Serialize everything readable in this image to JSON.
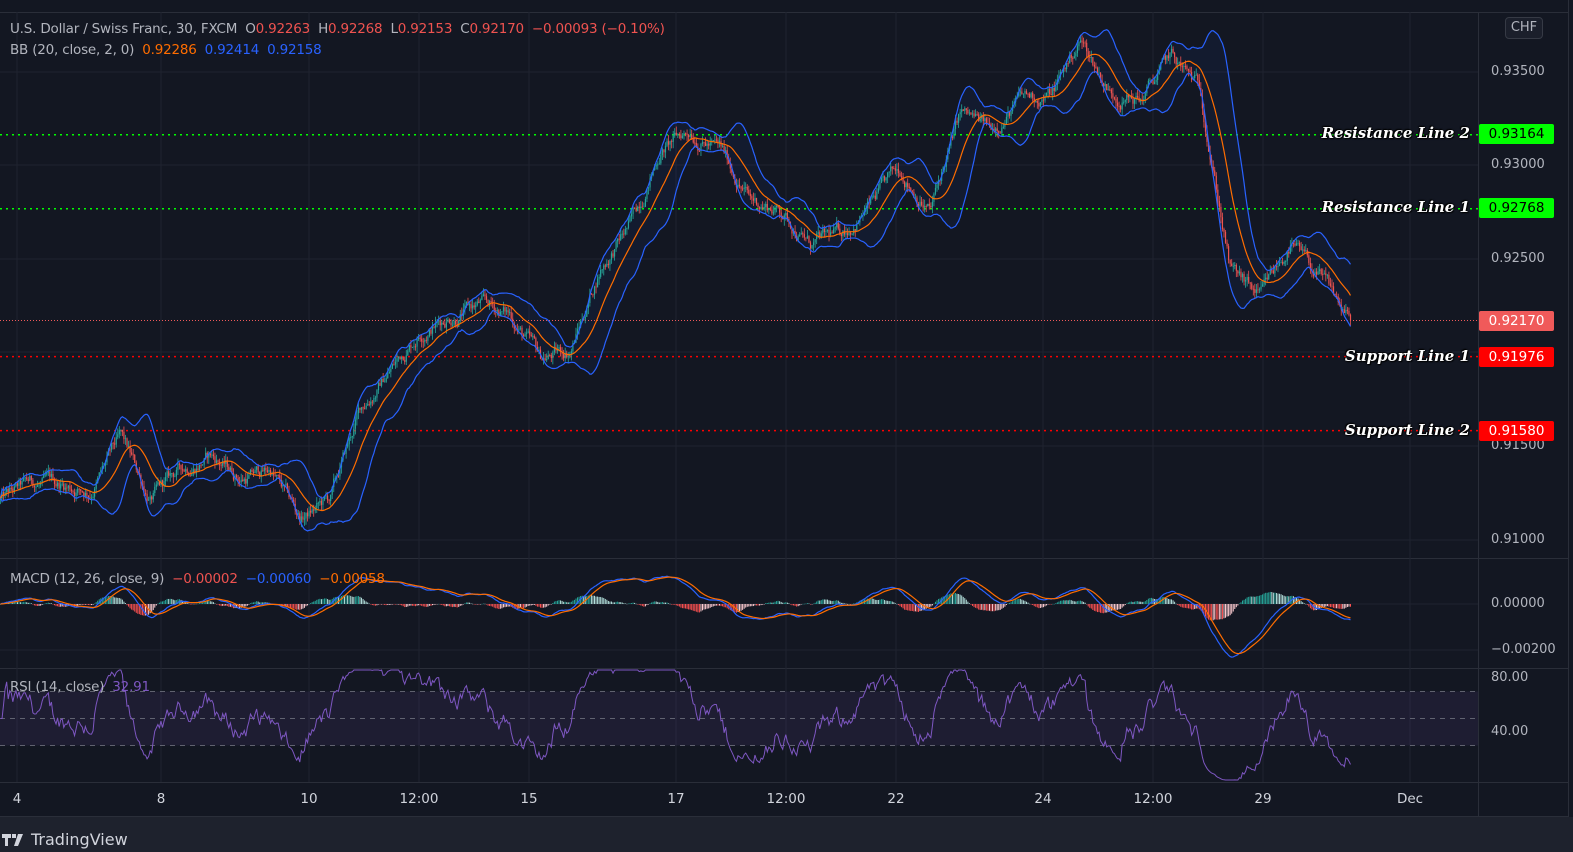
{
  "header": {
    "symbol": "U.S. Dollar / Swiss Franc, 30, FXCM",
    "open_label": "O",
    "open": "0.92263",
    "high_label": "H",
    "high": "0.92268",
    "low_label": "L",
    "low": "0.92153",
    "close_label": "C",
    "close": "0.92170",
    "change": "−0.00093 (−0.10%)"
  },
  "bb_legend": {
    "name": "BB (20, close, 2, 0)",
    "basis": "0.92286",
    "upper": "0.92414",
    "lower": "0.92158"
  },
  "macd_legend": {
    "name": "MACD (12, 26, close, 9)",
    "hist": "−0.00002",
    "macd": "−0.00060",
    "signal": "−0.00058"
  },
  "rsi_legend": {
    "name": "RSI (14, close)",
    "value": "32.91"
  },
  "currency": "CHF",
  "price_axis": [
    "0.93500",
    "0.93000",
    "0.92500",
    "0.91500",
    "0.91000"
  ],
  "macd_axis": [
    "0.00000",
    "−0.00200"
  ],
  "rsi_axis": [
    "80.00",
    "40.00"
  ],
  "time_axis": [
    "4",
    "8",
    "10",
    "12:00",
    "15",
    "17",
    "12:00",
    "22",
    "24",
    "12:00",
    "29",
    "Dec"
  ],
  "levels": [
    {
      "label": "Resistance Line 2",
      "price": "0.93164",
      "color": "#00ff00"
    },
    {
      "label": "Resistance Line 1",
      "price": "0.92768",
      "color": "#00ff00"
    },
    {
      "label": "Support Line 1",
      "price": "0.91976",
      "color": "#ff0000"
    },
    {
      "label": "Support Line 2",
      "price": "0.91580",
      "color": "#ff0000"
    }
  ],
  "last_price": {
    "price": "0.92170",
    "color": "#f05a5a"
  },
  "footer": {
    "brand": "TradingView"
  },
  "colors": {
    "up": "#26a69a",
    "down": "#ef5350",
    "bb_band": "#2962ff",
    "bb_basis": "#ff6d00",
    "macd": "#2962ff",
    "signal": "#ff6d00",
    "rsi": "#7e57c2",
    "background": "#131722"
  },
  "chart_data": {
    "type": "candlestick",
    "title": "U.S. Dollar / Swiss Franc, 30, FXCM",
    "ylim": [
      0.9085,
      0.9395
    ],
    "x_ticks": [
      "4",
      "8",
      "10",
      "12:00",
      "15",
      "17",
      "12:00",
      "22",
      "24",
      "12:00",
      "29",
      "Dec"
    ],
    "y_ticks": [
      0.935,
      0.93,
      0.925,
      0.915,
      0.91
    ],
    "approx_close_path": [
      0.91209,
      0.91289,
      0.91289,
      0.91262,
      0.9153,
      0.91209,
      0.91369,
      0.9145,
      0.91327,
      0.91369,
      0.91102,
      0.91209,
      0.91691,
      0.91905,
      0.92119,
      0.92199,
      0.92253,
      0.92199,
      0.91958,
      0.92012,
      0.92451,
      0.92681,
      0.93082,
      0.9319,
      0.93082,
      0.92815,
      0.92761,
      0.92574,
      0.92627,
      0.92788,
      0.92975,
      0.92761,
      0.9327,
      0.9319,
      0.9335,
      0.93377,
      0.93671,
      0.93393,
      0.9335,
      0.93575,
      0.93404,
      0.9244,
      0.92279,
      0.92574,
      0.92387,
      0.9217
    ],
    "horizontal_levels": [
      0.93164,
      0.92768,
      0.91976,
      0.9158
    ],
    "last_close": 0.9217,
    "grid": true
  }
}
